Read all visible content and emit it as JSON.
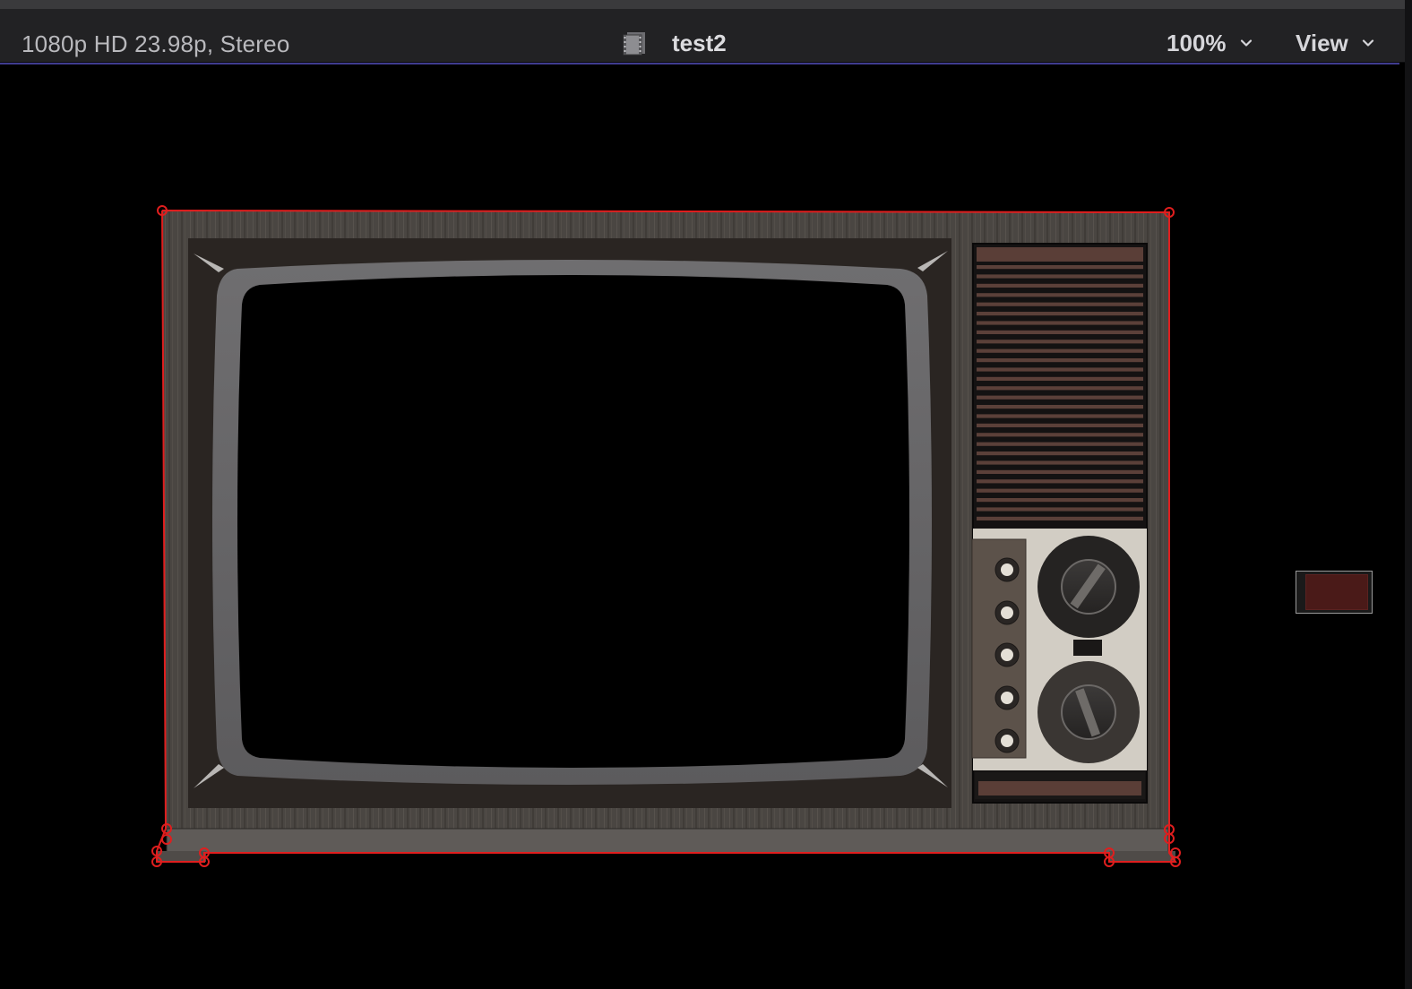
{
  "viewer": {
    "format_info": "1080p HD 23.98p, Stereo",
    "project_name": "test2",
    "zoom_label": "100%",
    "view_label": "View"
  },
  "icons": {
    "project": "filmstrip-icon",
    "zoom_menu": "chevron-down-icon",
    "view_menu": "chevron-down-icon"
  },
  "colors": {
    "toolbar_bg": "#222224",
    "accent_line": "#3f3c8f",
    "selection_outline": "#e01e1e",
    "canvas_bg": "#000000"
  }
}
